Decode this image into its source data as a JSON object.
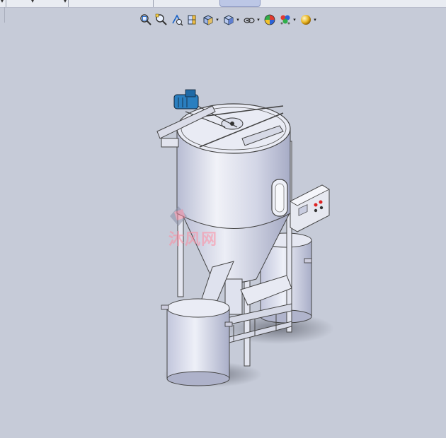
{
  "window": {
    "tabs": [
      "",
      "",
      ""
    ],
    "active_tab_label": ""
  },
  "toolbar": {
    "icons": [
      "zoom-to-fit-icon",
      "zoom-to-area-icon",
      "previous-view-icon",
      "section-view-icon",
      "view-orientation-icon",
      "display-style-icon",
      "hide-show-items-icon",
      "edit-appearance-icon",
      "apply-scene-icon",
      "view-settings-icon"
    ]
  },
  "viewport": {
    "model": "vertical-feed-mixer-assembly",
    "watermark_text": "沐风网"
  },
  "colors": {
    "background": "#c6cbd8",
    "metal": "#d8dae8",
    "motor": "#2a7fc0",
    "panel": "#e6e8f0",
    "watermark": "#ff8ca0"
  }
}
